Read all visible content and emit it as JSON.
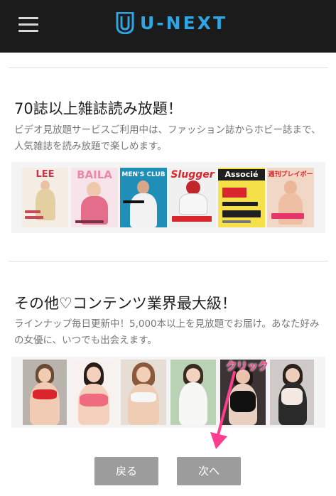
{
  "header": {
    "logo_text": "U-NEXT",
    "brand_color": "#2fa6e3",
    "menu_icon": "hamburger-menu-icon"
  },
  "magazine_section": {
    "title": "70誌以上雑誌読み放題！",
    "description": "ビデオ見放題サービスご利用中は、ファッション誌からホビー誌まで、人気雑誌を読み放題で楽しめます。",
    "covers": [
      {
        "masthead": "LEE",
        "text": "「自然体」を作る、好感度上げ服"
      },
      {
        "masthead": "BAILA",
        "text": "人気連載"
      },
      {
        "masthead": "MEN'S CLUB",
        "text": "大人の"
      },
      {
        "masthead": "Slugger",
        "text": "野球ガイド"
      },
      {
        "masthead": "Associé",
        "text": "40代すべきこと72"
      },
      {
        "masthead": "週刊プレイボーイ",
        "text": "グラビア越え"
      }
    ]
  },
  "content_section": {
    "title": "その他♡コンテンツ業界最大級！",
    "description": "ラインナップ毎日更新中！5,000本以上を見放題でお届け。あなた好みの女優に、いつでも出会えます。"
  },
  "annotation": {
    "label": "クリック",
    "color": "#ff3d8e"
  },
  "buttons": {
    "back": "戻る",
    "next": "次へ"
  }
}
